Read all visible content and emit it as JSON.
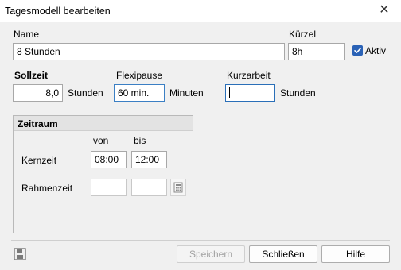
{
  "window": {
    "title": "Tagesmodell bearbeiten"
  },
  "fields": {
    "name": {
      "label": "Name",
      "value": "8 Stunden"
    },
    "kuerzel": {
      "label": "Kürzel",
      "value": "8h"
    },
    "aktiv": {
      "label": "Aktiv",
      "checked": true
    }
  },
  "sollzeit": {
    "label": "Sollzeit",
    "value": "8,0",
    "unit": "Stunden"
  },
  "flexipause": {
    "label": "Flexipause",
    "value": "60 min.",
    "unit": "Minuten"
  },
  "kurzarbeit": {
    "label": "Kurzarbeit",
    "value": "",
    "unit": "Stunden"
  },
  "zeitraum": {
    "title": "Zeitraum",
    "col_von": "von",
    "col_bis": "bis",
    "kernzeit": {
      "label": "Kernzeit",
      "von": "08:00",
      "bis": "12:00"
    },
    "rahmenzeit": {
      "label": "Rahmenzeit",
      "von": "",
      "bis": ""
    }
  },
  "footer": {
    "save_label": "Speichern",
    "close_label": "Schließen",
    "help_label": "Hilfe"
  },
  "icons": {
    "close": "close-icon",
    "checkbox": "checkmark-icon",
    "calculator": "calculator-icon",
    "save": "floppy-disk-icon"
  },
  "colors": {
    "accent": "#2a62b6",
    "focus_border": "#3b7fc4"
  }
}
